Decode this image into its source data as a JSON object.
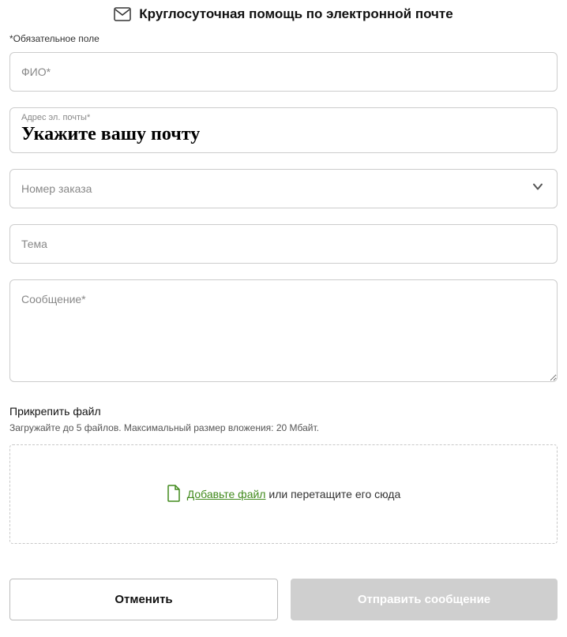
{
  "header": {
    "title": "Круглосуточная помощь по электронной почте"
  },
  "required_note": "*Обязательное поле",
  "fields": {
    "name_placeholder": "ФИО*",
    "email_label": "Адрес эл. почты*",
    "email_value": "Укажите вашу почту",
    "order_placeholder": "Номер заказа",
    "subject_placeholder": "Тема",
    "message_placeholder": "Сообщение*"
  },
  "attach": {
    "title": "Прикрепить файл",
    "hint": "Загружайте до 5 файлов. Максимальный размер вложения: 20 Мбайт.",
    "add_link": "Добавьте файл",
    "drop_text": " или перетащите его сюда"
  },
  "buttons": {
    "cancel": "Отменить",
    "submit": "Отправить сообщение"
  }
}
